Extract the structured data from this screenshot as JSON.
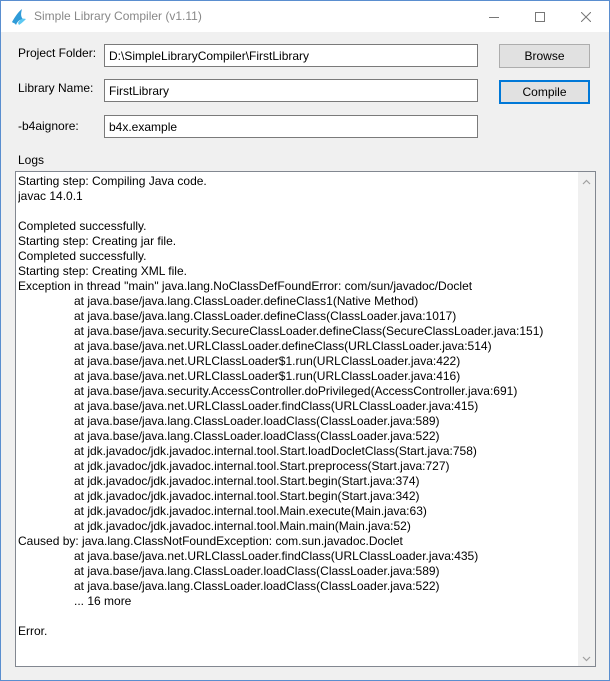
{
  "window": {
    "title": "Simple Library Compiler (v1.11)"
  },
  "form": {
    "project_folder_label": "Project Folder:",
    "project_folder_value": "D:\\SimpleLibraryCompiler\\FirstLibrary",
    "library_name_label": "Library Name:",
    "library_name_value": "FirstLibrary",
    "ignore_label": "-b4aignore:",
    "ignore_value": "b4x.example",
    "browse_label": "Browse",
    "compile_label": "Compile"
  },
  "logs": {
    "label": "Logs",
    "lines": [
      {
        "text": "Starting step: Compiling Java code.",
        "indent": false
      },
      {
        "text": "javac 14.0.1",
        "indent": false
      },
      {
        "text": "",
        "indent": false
      },
      {
        "text": "Completed successfully.",
        "indent": false
      },
      {
        "text": "Starting step: Creating jar file.",
        "indent": false
      },
      {
        "text": "Completed successfully.",
        "indent": false
      },
      {
        "text": "Starting step: Creating XML file.",
        "indent": false
      },
      {
        "text": "Exception in thread \"main\" java.lang.NoClassDefFoundError: com/sun/javadoc/Doclet",
        "indent": false
      },
      {
        "text": "at java.base/java.lang.ClassLoader.defineClass1(Native Method)",
        "indent": true
      },
      {
        "text": "at java.base/java.lang.ClassLoader.defineClass(ClassLoader.java:1017)",
        "indent": true
      },
      {
        "text": "at java.base/java.security.SecureClassLoader.defineClass(SecureClassLoader.java:151)",
        "indent": true
      },
      {
        "text": "at java.base/java.net.URLClassLoader.defineClass(URLClassLoader.java:514)",
        "indent": true
      },
      {
        "text": "at java.base/java.net.URLClassLoader$1.run(URLClassLoader.java:422)",
        "indent": true
      },
      {
        "text": "at java.base/java.net.URLClassLoader$1.run(URLClassLoader.java:416)",
        "indent": true
      },
      {
        "text": "at java.base/java.security.AccessController.doPrivileged(AccessController.java:691)",
        "indent": true
      },
      {
        "text": "at java.base/java.net.URLClassLoader.findClass(URLClassLoader.java:415)",
        "indent": true
      },
      {
        "text": "at java.base/java.lang.ClassLoader.loadClass(ClassLoader.java:589)",
        "indent": true
      },
      {
        "text": "at java.base/java.lang.ClassLoader.loadClass(ClassLoader.java:522)",
        "indent": true
      },
      {
        "text": "at jdk.javadoc/jdk.javadoc.internal.tool.Start.loadDocletClass(Start.java:758)",
        "indent": true
      },
      {
        "text": "at jdk.javadoc/jdk.javadoc.internal.tool.Start.preprocess(Start.java:727)",
        "indent": true
      },
      {
        "text": "at jdk.javadoc/jdk.javadoc.internal.tool.Start.begin(Start.java:374)",
        "indent": true
      },
      {
        "text": "at jdk.javadoc/jdk.javadoc.internal.tool.Start.begin(Start.java:342)",
        "indent": true
      },
      {
        "text": "at jdk.javadoc/jdk.javadoc.internal.tool.Main.execute(Main.java:63)",
        "indent": true
      },
      {
        "text": "at jdk.javadoc/jdk.javadoc.internal.tool.Main.main(Main.java:52)",
        "indent": true
      },
      {
        "text": "Caused by: java.lang.ClassNotFoundException: com.sun.javadoc.Doclet",
        "indent": false
      },
      {
        "text": "at java.base/java.net.URLClassLoader.findClass(URLClassLoader.java:435)",
        "indent": true
      },
      {
        "text": "at java.base/java.lang.ClassLoader.loadClass(ClassLoader.java:589)",
        "indent": true
      },
      {
        "text": "at java.base/java.lang.ClassLoader.loadClass(ClassLoader.java:522)",
        "indent": true
      },
      {
        "text": "... 16 more",
        "indent": true
      },
      {
        "text": "",
        "indent": false
      },
      {
        "text": "Error.",
        "indent": false
      }
    ]
  },
  "icons": {
    "app": "b4x-app-icon",
    "minimize": "minimize-icon",
    "maximize": "maximize-icon",
    "close": "close-icon"
  },
  "colors": {
    "accent": "#0078d7",
    "window_border": "#5a8ecf"
  }
}
